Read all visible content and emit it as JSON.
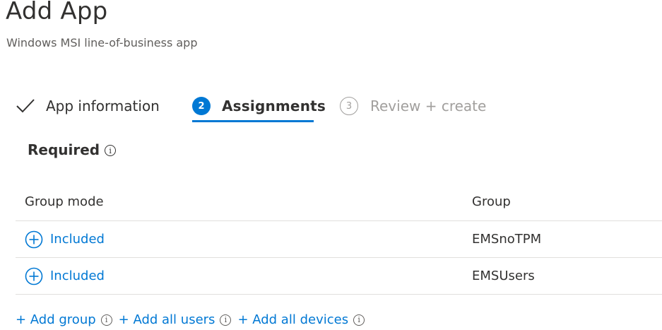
{
  "page": {
    "title": "Add App",
    "subtitle": "Windows MSI line-of-business app"
  },
  "wizard": {
    "steps": [
      {
        "number": "",
        "label": "App information",
        "state": "completed"
      },
      {
        "number": "2",
        "label": "Assignments",
        "state": "active"
      },
      {
        "number": "3",
        "label": "Review + create",
        "state": "upcoming"
      }
    ]
  },
  "section": {
    "title": "Required",
    "info_icon": "info-icon"
  },
  "table": {
    "columns": [
      "Group mode",
      "Group"
    ],
    "rows": [
      {
        "mode": "Included",
        "group": "EMSnoTPM"
      },
      {
        "mode": "Included",
        "group": "EMSUsers"
      }
    ]
  },
  "actions": {
    "add_group": "+ Add group",
    "add_all_users": "+ Add all users",
    "add_all_devices": "+ Add all devices"
  },
  "colors": {
    "accent": "#0078d4",
    "text": "#323130",
    "muted": "#a19f9d",
    "divider": "#e1dfdd"
  }
}
